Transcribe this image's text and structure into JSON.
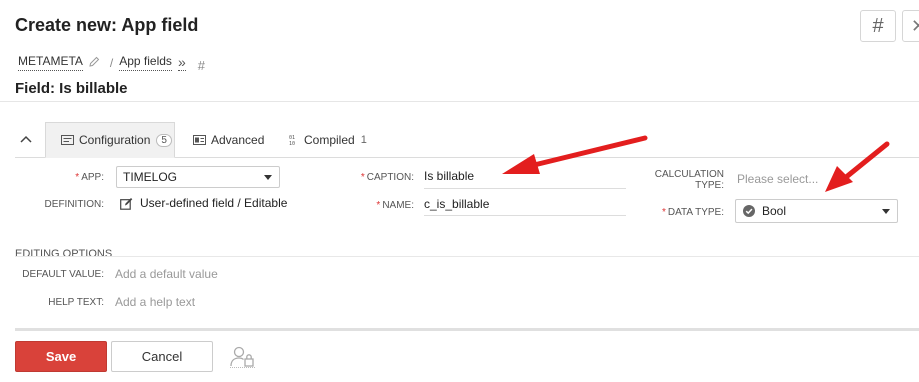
{
  "header": {
    "title": "Create new: App field",
    "hash_label": "#",
    "close_label": "✕"
  },
  "breadcrumb": {
    "items": [
      "METAMETA",
      "App fields"
    ],
    "separator": "/",
    "more_label": "»",
    "hash_label": "#"
  },
  "subtitle": "Field: Is billable",
  "tabs": [
    {
      "label": "Configuration",
      "count": "5",
      "icon": "card-icon"
    },
    {
      "label": "Advanced",
      "icon": "id-card-icon"
    },
    {
      "label": "Compiled",
      "count": "1",
      "icon": "code-icon"
    }
  ],
  "collapse_label": "^",
  "form": {
    "app_label": "APP:",
    "app_value": "TIMELOG",
    "definition_label": "DEFINITION:",
    "definition_value": "User-defined field / Editable",
    "caption_label": "CAPTION:",
    "caption_value": "Is billable",
    "name_label": "NAME:",
    "name_value": "c_is_billable",
    "calc_type_label_1": "CALCULATION",
    "calc_type_label_2": "TYPE:",
    "calc_type_placeholder": "Please select...",
    "data_type_label": "DATA TYPE:",
    "data_type_value": "Bool",
    "required_mark": "*"
  },
  "editing_options": {
    "title": "EDITING OPTIONS",
    "default_label": "DEFAULT VALUE:",
    "default_placeholder": "Add a default value",
    "help_label": "HELP TEXT:",
    "help_placeholder": "Add a help text"
  },
  "footer": {
    "save_label": "Save",
    "cancel_label": "Cancel"
  },
  "colors": {
    "accent_red": "#d9423a",
    "required_red": "#d33333",
    "annotation_arrow": "#e31e1e"
  }
}
